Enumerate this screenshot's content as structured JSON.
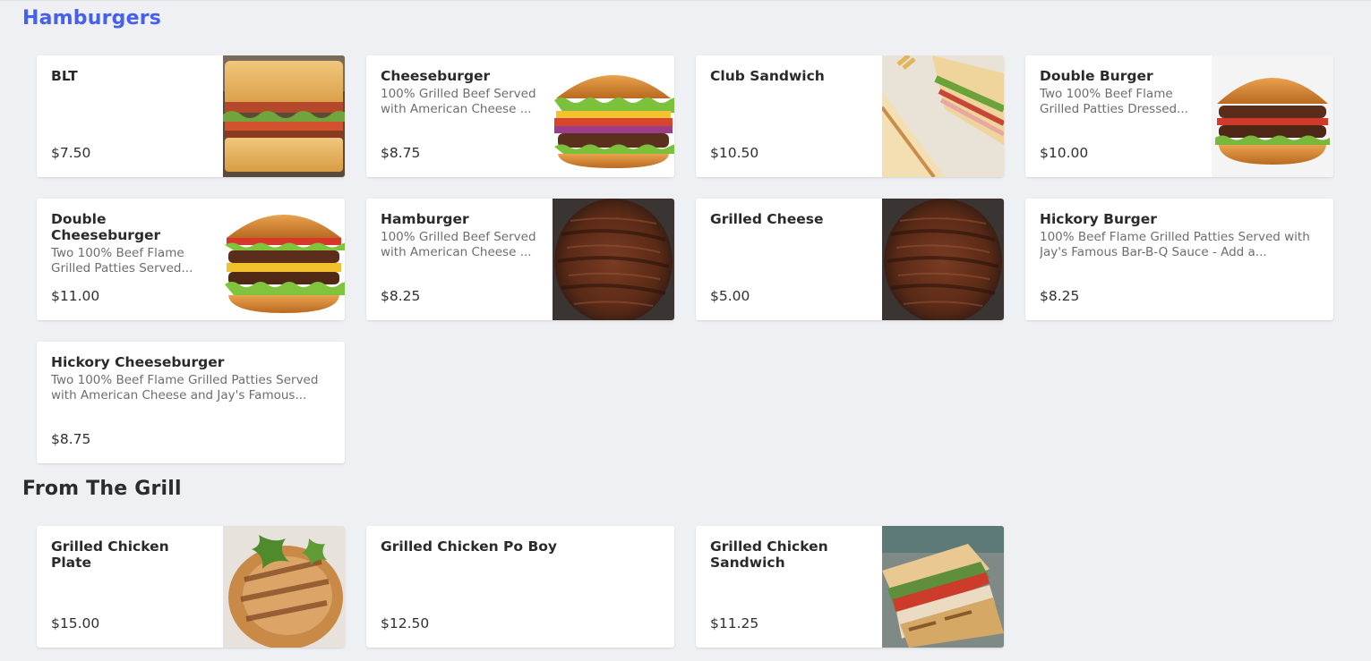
{
  "sections": {
    "hamburgers": {
      "title": "Hamburgers",
      "items": [
        {
          "name": "BLT",
          "desc": "",
          "price": "$7.50",
          "image": "blt-sandwich-image"
        },
        {
          "name": "Cheeseburger",
          "desc": "100% Grilled Beef Served with American Cheese ...",
          "price": "$8.75",
          "image": "cheeseburger-image"
        },
        {
          "name": "Club Sandwich",
          "desc": "",
          "price": "$10.50",
          "image": "club-sandwich-image"
        },
        {
          "name": "Double Burger",
          "desc": "Two 100% Beef Flame Grilled Patties Dressed...",
          "price": "$10.00",
          "image": "double-burger-image"
        },
        {
          "name": "Double Cheeseburger",
          "desc": "Two 100% Beef Flame Grilled Patties Served...",
          "price": "$11.00",
          "image": "double-cheeseburger-image"
        },
        {
          "name": "Hamburger",
          "desc": "100% Grilled Beef Served with American Cheese ...",
          "price": "$8.25",
          "image": "grilled-patty-image"
        },
        {
          "name": "Grilled Cheese",
          "desc": "",
          "price": "$5.00",
          "image": "grilled-patty-image"
        },
        {
          "name": "Hickory Burger",
          "desc": "100% Beef Flame Grilled Patties Served with Jay's Famous Bar-B-Q Sauce - Add a...",
          "price": "$8.25",
          "image": ""
        },
        {
          "name": "Hickory Cheeseburger",
          "desc": "Two 100% Beef Flame Grilled Patties Served with American Cheese and Jay's Famous...",
          "price": "$8.75",
          "image": ""
        }
      ]
    },
    "grill": {
      "title": "From The Grill",
      "items": [
        {
          "name": "Grilled Chicken Plate",
          "desc": "",
          "price": "$15.00",
          "image": "grilled-chicken-image"
        },
        {
          "name": "Grilled Chicken Po Boy",
          "desc": "",
          "price": "$12.50",
          "image": ""
        },
        {
          "name": "Grilled Chicken Sandwich",
          "desc": "",
          "price": "$11.25",
          "image": "panini-sandwich-image"
        }
      ]
    }
  }
}
